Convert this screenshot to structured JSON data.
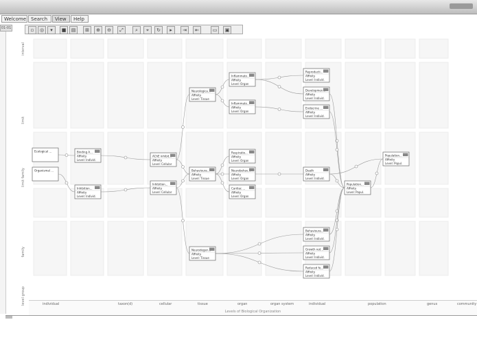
{
  "menu": {
    "tabs": [
      "Welcome",
      "Search",
      "View",
      "Help"
    ],
    "active": "View"
  },
  "left_index": "01-01",
  "row_labels": [
    "interval",
    "limit",
    "limit family",
    "family",
    "level group"
  ],
  "column_labels": [
    "individual",
    "taxon(d)",
    "cellular",
    "tissue",
    "organ",
    "organ system",
    "individual",
    "population",
    "genus",
    "community"
  ],
  "bottom_axis_title": "Levels of Biological Organization",
  "nodes": [
    {
      "id": "L1",
      "title": "Ecological ...",
      "l2": "",
      "l3": ""
    },
    {
      "id": "L2",
      "title": "Organismal ...",
      "l2": "",
      "l3": ""
    },
    {
      "id": "A1",
      "title": "Binding A...",
      "l2": "Affinity",
      "l3": "Level: Individ."
    },
    {
      "id": "A2",
      "title": "Inhibition...",
      "l2": "Affinity",
      "l3": "Level: Individ."
    },
    {
      "id": "B1",
      "title": "AChE inhibit...",
      "l2": "Affinity",
      "l3": "Level: Cellular"
    },
    {
      "id": "B2",
      "title": "Inhibition...",
      "l2": "Affinity",
      "l3": "Level: Cellular"
    },
    {
      "id": "C1",
      "title": "Neurologica...",
      "l2": "Affinity",
      "l3": "Level: Tissue"
    },
    {
      "id": "C2",
      "title": "Behavioura...",
      "l2": "Affinity",
      "l3": "Level: Tissue"
    },
    {
      "id": "C3",
      "title": "Neurodegen...",
      "l2": "Affinity",
      "l3": "Level: Tissue"
    },
    {
      "id": "D1",
      "title": "Inflammato...",
      "l2": "Affinity",
      "l3": "Level: Organ"
    },
    {
      "id": "D2",
      "title": "Inflammato...",
      "l2": "Affinity",
      "l3": "Level: Organ"
    },
    {
      "id": "D3",
      "title": "Respiratio...",
      "l2": "Affinity",
      "l3": "Level: Organ"
    },
    {
      "id": "D4",
      "title": "Neurobehav...",
      "l2": "Affinity",
      "l3": "Level: Organ"
    },
    {
      "id": "D5",
      "title": "Cardiac ...",
      "l2": "Affinity",
      "l3": "Level: Organ"
    },
    {
      "id": "E1",
      "title": "Reproducti...",
      "l2": "Affinity",
      "l3": "Level: Individ."
    },
    {
      "id": "E2",
      "title": "Developmen...",
      "l2": "Affinity",
      "l3": "Level: Individ."
    },
    {
      "id": "E3",
      "title": "Endocrine ...",
      "l2": "Affinity",
      "l3": "Level: Individ."
    },
    {
      "id": "E4",
      "title": "Death",
      "l2": "Affinity",
      "l3": "Level: Individ."
    },
    {
      "id": "E5",
      "title": "Behavioura...",
      "l2": "Affinity",
      "l3": "Level: Individ."
    },
    {
      "id": "E6",
      "title": "Growth red...",
      "l2": "Affinity",
      "l3": "Level: Individ."
    },
    {
      "id": "E7",
      "title": "Reduced fe...",
      "l2": "Affinity",
      "l3": "Level: Individ."
    },
    {
      "id": "F1",
      "title": "Population...",
      "l2": "Affinity",
      "l3": "Level: Popul."
    },
    {
      "id": "F2",
      "title": "Population...",
      "l2": "Affinity",
      "l3": "Level: Popul."
    }
  ],
  "colors": {
    "badge": "#888888",
    "node_border": "#666666",
    "edge": "#999999",
    "grid_cell": "#f6f6f6"
  },
  "icons": [
    "new-icon",
    "open-icon",
    "save-icon",
    "gear-icon",
    "table-icon",
    "layout-icon",
    "zoom-in-icon",
    "zoom-out-icon",
    "fit-icon",
    "search-icon",
    "select-icon",
    "pointer-icon",
    "export-icon",
    "import-icon",
    "folder-icon",
    "disk-icon"
  ]
}
